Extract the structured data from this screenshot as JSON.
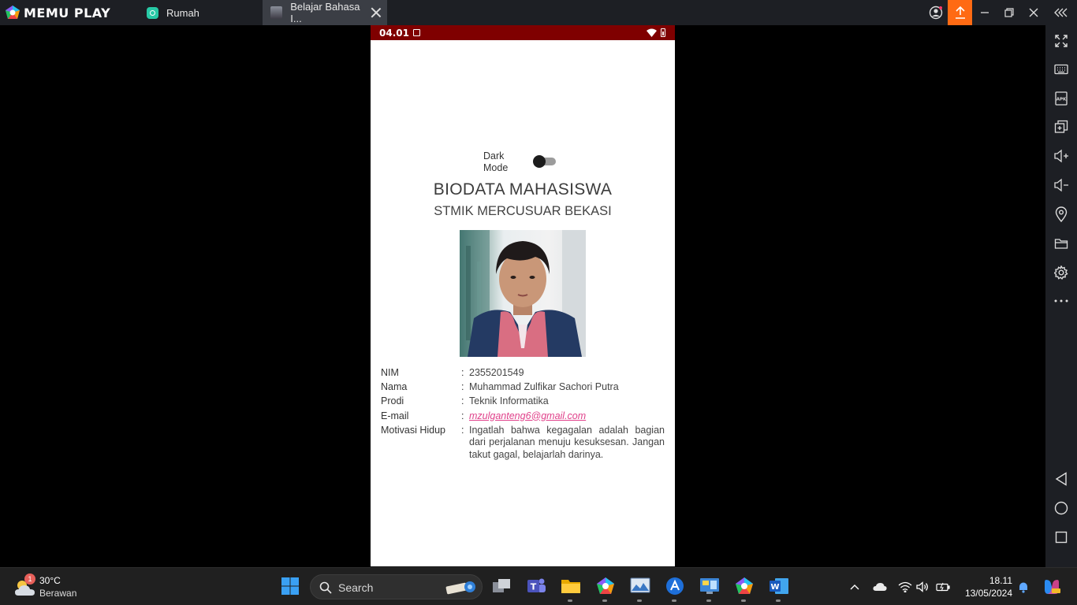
{
  "app": {
    "logo_text": "MEMU PLAY"
  },
  "tabs": [
    {
      "label": "Rumah"
    },
    {
      "label": "Belajar Bahasa I..."
    }
  ],
  "colors": {
    "accent": "#ff6a13",
    "statusbar": "#7f0000",
    "email": "#e0408a"
  },
  "phone": {
    "status": {
      "time": "04.01"
    },
    "dark_mode": {
      "label": "Dark Mode",
      "enabled": false
    },
    "title": "BIODATA MAHASISWA",
    "subtitle": "STMIK MERCUSUAR BEKASI",
    "bio": [
      {
        "label": "NIM",
        "sep": ":",
        "value": "2355201549"
      },
      {
        "label": "Nama",
        "sep": ":",
        "value": "Muhammad Zulfikar Sachori Putra"
      },
      {
        "label": "Prodi",
        "sep": ":",
        "value": "Teknik Informatika"
      },
      {
        "label": "E-mail",
        "sep": ":",
        "value": "mzulganteng6@gmail.com"
      },
      {
        "label": "Motivasi Hidup",
        "sep": ":",
        "value": "Ingatlah bahwa kegagalan adalah bagian dari perjalanan menuju kesuksesan. Jangan takut gagal, belajarlah darinya."
      }
    ]
  },
  "sidebar_icons": [
    "fullscreen-icon",
    "keyboard-icon",
    "apk-icon",
    "multi-window-icon",
    "volume-up-icon",
    "volume-down-icon",
    "location-icon",
    "folder-icon",
    "settings-icon",
    "more-icon",
    "back-icon",
    "home-icon",
    "recents-icon"
  ],
  "taskbar": {
    "weather": {
      "temp": "30°C",
      "desc": "Berawan",
      "badge": "1"
    },
    "search_label": "Search",
    "clock": {
      "time": "18.11",
      "date": "13/05/2024"
    }
  }
}
